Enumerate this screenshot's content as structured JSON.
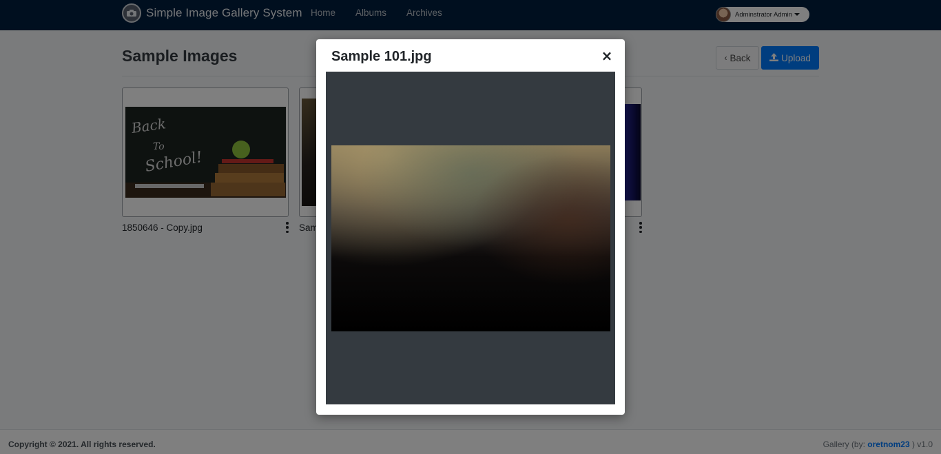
{
  "navbar": {
    "brand": "Simple Image Gallery System",
    "links": [
      "Home",
      "Albums",
      "Archives"
    ],
    "user": "Adminstrator Admin"
  },
  "page": {
    "title": "Sample Images",
    "back_label": "Back",
    "upload_label": "Upload"
  },
  "cards": [
    {
      "caption": "1850646 - Copy.jpg"
    },
    {
      "caption": "Sam"
    },
    {
      "caption": ""
    }
  ],
  "footer": {
    "copyright": "Copyright © 2021. All rights reserved.",
    "credit_prefix": "Gallery (by: ",
    "credit_author": "oretnom23",
    "credit_suffix": " ) v1.0"
  },
  "modal": {
    "title": "Sample 101.jpg",
    "close_glyph": "×"
  },
  "colors": {
    "navbar": "#001f3f",
    "primary": "#007bff",
    "modal_body": "#343a40"
  },
  "icons": [
    "camera-icon",
    "chevron-left-icon",
    "upload-icon",
    "kebab-icon",
    "close-icon"
  ]
}
